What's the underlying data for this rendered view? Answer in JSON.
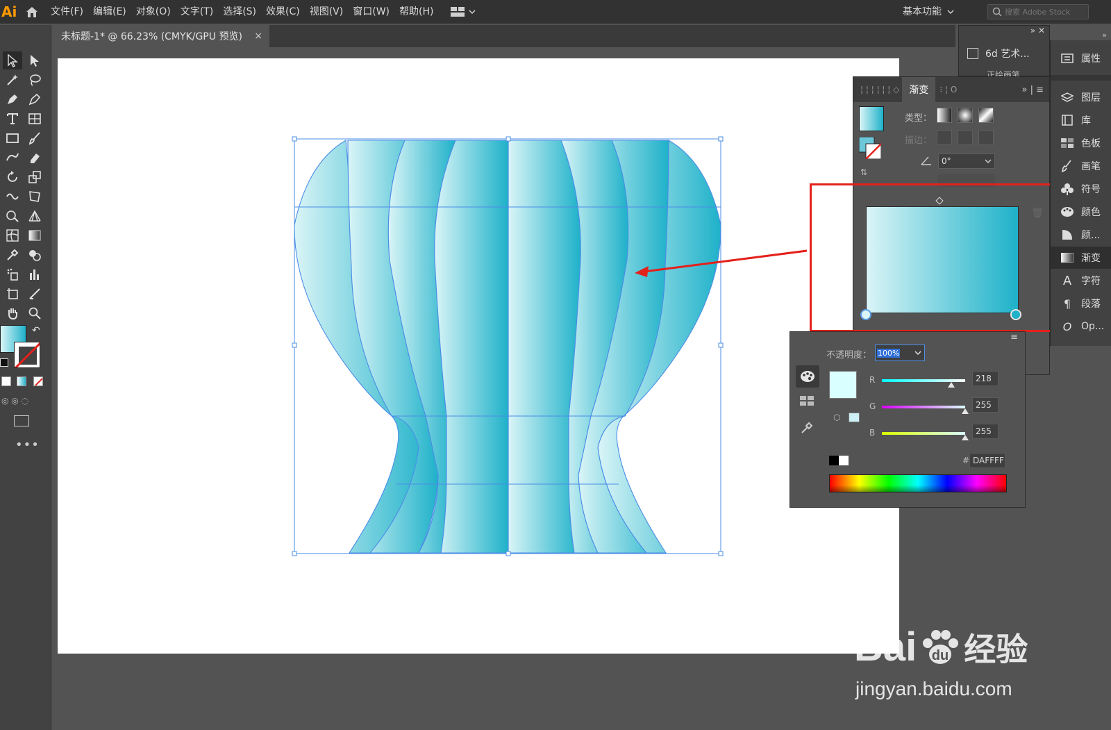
{
  "app": {
    "logo": "Ai"
  },
  "menu": {
    "items": [
      "文件(F)",
      "编辑(E)",
      "对象(O)",
      "文字(T)",
      "选择(S)",
      "效果(C)",
      "视图(V)",
      "窗口(W)",
      "帮助(H)"
    ]
  },
  "workspace": {
    "label": "基本功能"
  },
  "search": {
    "placeholder": "搜索 Adobe Stock"
  },
  "document": {
    "tab_title": "未标题-1* @ 66.23% (CMYK/GPU 预览)",
    "close": "×"
  },
  "top_panels": {
    "art_label": "6d 艺术...",
    "art_sub": "正绘画笔"
  },
  "gradient_panel": {
    "tab_label": "渐变",
    "type_label": "类型：",
    "stroke_label": "描边：",
    "angle_value": "0°",
    "start_color": "#daf5f7",
    "end_color": "#1eb1c9"
  },
  "color_popup": {
    "opacity_label": "不透明度：",
    "opacity_value": "100%",
    "r_label": "R",
    "g_label": "G",
    "b_label": "B",
    "r_value": "218",
    "g_value": "255",
    "b_value": "255",
    "hash_label": "#",
    "hex_value": "DAFFFF",
    "swatch_color": "#daffff"
  },
  "right_panels": {
    "properties": "属性",
    "items": [
      "图层",
      "库",
      "色板",
      "画笔",
      "符号",
      "颜色",
      "颜...",
      "渐变",
      "字符",
      "段落",
      "Op..."
    ]
  },
  "watermark": {
    "brand": "Bai",
    "brand_tail": "经验",
    "url": "jingyan.baidu.com"
  }
}
